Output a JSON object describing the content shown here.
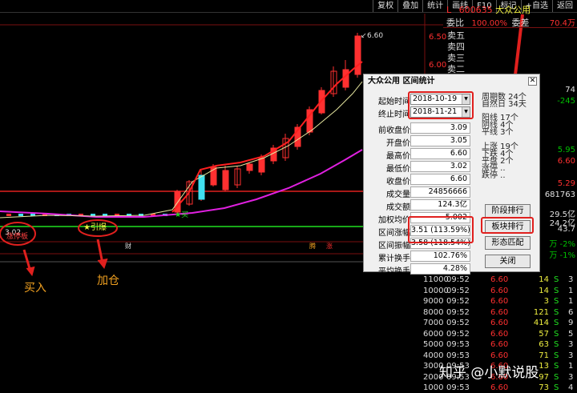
{
  "toolbar": {
    "items": [
      "复权",
      "叠加",
      "统计",
      "画线",
      "F10",
      "标记",
      "+自选",
      "返回"
    ]
  },
  "stock": {
    "prefix": "L",
    "code": "600635",
    "name": "大众公用",
    "weibi_label": "委比",
    "weibi_value": "100.00%",
    "weicha_label": "委差",
    "weicha_value": "70.4万"
  },
  "orderbook_labels": [
    "卖五",
    "卖四",
    "卖三",
    "卖二"
  ],
  "price_axis": [
    "6.50",
    "6.00"
  ],
  "chart": {
    "high_label": "6.60",
    "low_label": "3.02",
    "buy_tag": "涨停板",
    "add_tag": "★引爆",
    "buy_mark": "★买",
    "bottom_marks": [
      "财",
      "腾",
      "涨"
    ]
  },
  "annotations": {
    "buy": "买入",
    "add": "加仓"
  },
  "dialog": {
    "title": "大众公用 区间统计",
    "start_label": "起始时间",
    "start_value": "2018-10-19",
    "end_label": "终止时间",
    "end_value": "2018-11-21",
    "rows": [
      {
        "label": "前收盘价",
        "value": "3.09"
      },
      {
        "label": "开盘价",
        "value": "3.05"
      },
      {
        "label": "最高价",
        "value": "6.60"
      },
      {
        "label": "最低价",
        "value": "3.02"
      },
      {
        "label": "收盘价",
        "value": "6.60"
      },
      {
        "label": "成交量",
        "value": "24856666"
      },
      {
        "label": "成交额",
        "value": "124.3亿"
      },
      {
        "label": "加权均价",
        "value": "5.002"
      },
      {
        "label": "区间涨幅",
        "value": "3.51 (113.59%)"
      },
      {
        "label": "区间振幅",
        "value": "3.58 (118.54%)"
      },
      {
        "label": "累计换手",
        "value": "102.76%"
      },
      {
        "label": "平均换手",
        "value": "4.28%"
      }
    ],
    "stats_a": [
      "周期数 24个",
      "自然日 34天"
    ],
    "stats_b": [
      "阳线 17个",
      "阴线 4个",
      "平线 3个"
    ],
    "stats_c": [
      "上涨 19个",
      "下跌 4个",
      "平盘 2个",
      "涨停 ..",
      "跌停 .."
    ],
    "buttons": [
      "阶段排行",
      "板块排行",
      "形态匹配",
      "关闭"
    ]
  },
  "right_values": [
    {
      "v": "74",
      "c": "#e0e0e0"
    },
    {
      "v": "-245",
      "c": "#00c000"
    },
    {
      "v": "5.95",
      "c": "#00c000"
    },
    {
      "v": "6.60",
      "c": "#ff3030"
    },
    {
      "v": "5.29",
      "c": "#ff3030"
    },
    {
      "v": "681763",
      "c": "#e0e0e0"
    },
    {
      "v": "29.5亿",
      "c": "#e0e0e0"
    },
    {
      "v": "24.2亿",
      "c": "#e0e0e0"
    },
    {
      "v": "43.7",
      "c": "#e0e0e0"
    },
    {
      "v": "万 -2%",
      "c": "#00c000"
    },
    {
      "v": "万 -1%",
      "c": "#00c000"
    }
  ],
  "trades": [
    {
      "vol_left": "11000",
      "time": "09:52",
      "price": "6.60",
      "vol": "14",
      "dir": "S",
      "n": "3"
    },
    {
      "vol_left": "10000",
      "time": "09:52",
      "price": "6.60",
      "vol": "14",
      "dir": "S",
      "n": "1"
    },
    {
      "vol_left": "9000",
      "time": "09:52",
      "price": "6.60",
      "vol": "3",
      "dir": "S",
      "n": "1"
    },
    {
      "vol_left": "8000",
      "time": "09:52",
      "price": "6.60",
      "vol": "121",
      "dir": "S",
      "n": "6"
    },
    {
      "vol_left": "7000",
      "time": "09:52",
      "price": "6.60",
      "vol": "414",
      "dir": "S",
      "n": "9"
    },
    {
      "vol_left": "6000",
      "time": "09:52",
      "price": "6.60",
      "vol": "57",
      "dir": "S",
      "n": "5"
    },
    {
      "vol_left": "5000",
      "time": "09:53",
      "price": "6.60",
      "vol": "63",
      "dir": "S",
      "n": "3"
    },
    {
      "vol_left": "4000",
      "time": "09:53",
      "price": "6.60",
      "vol": "71",
      "dir": "S",
      "n": "3"
    },
    {
      "vol_left": "3000",
      "time": "09:53",
      "price": "6.60",
      "vol": "13",
      "dir": "S",
      "n": "1"
    },
    {
      "vol_left": "2000",
      "time": "09:53",
      "price": "6.60",
      "vol": "97",
      "dir": "S",
      "n": "3"
    },
    {
      "vol_left": "1000",
      "time": "09:53",
      "price": "6.60",
      "vol": "73",
      "dir": "S",
      "n": "4"
    }
  ],
  "watermark": "知乎 @小默说股"
}
